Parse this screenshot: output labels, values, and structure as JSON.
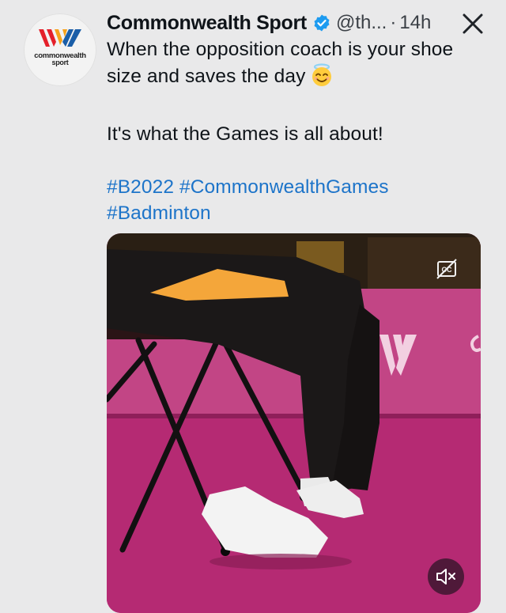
{
  "account": {
    "name": "Commonwealth Sport",
    "handle": "@th...",
    "separator": "·",
    "time": "14h",
    "logo_text_line1": "commonwealth",
    "logo_text_line2": "sport",
    "logo_colors": [
      "#e4202a",
      "#f7a21b",
      "#1a5ea8"
    ]
  },
  "tweet": {
    "line1": "When the opposition coach is your shoe",
    "line2": "size and saves the day",
    "emoji": "smiling-face-with-halo",
    "line3": "It's what the Games is all about!",
    "hashtags": [
      "#B2022",
      "#CommonwealthGames",
      "#Badminton"
    ]
  },
  "icons": {
    "verified": "verified-badge-icon",
    "close": "close-icon",
    "captions": "closed-captions-icon",
    "mute": "volume-muted-icon"
  },
  "colors": {
    "link": "#1d74c9",
    "verified": "#1d9bf0",
    "floor": "#b52a73"
  },
  "media": {
    "captions_label": "CC"
  }
}
